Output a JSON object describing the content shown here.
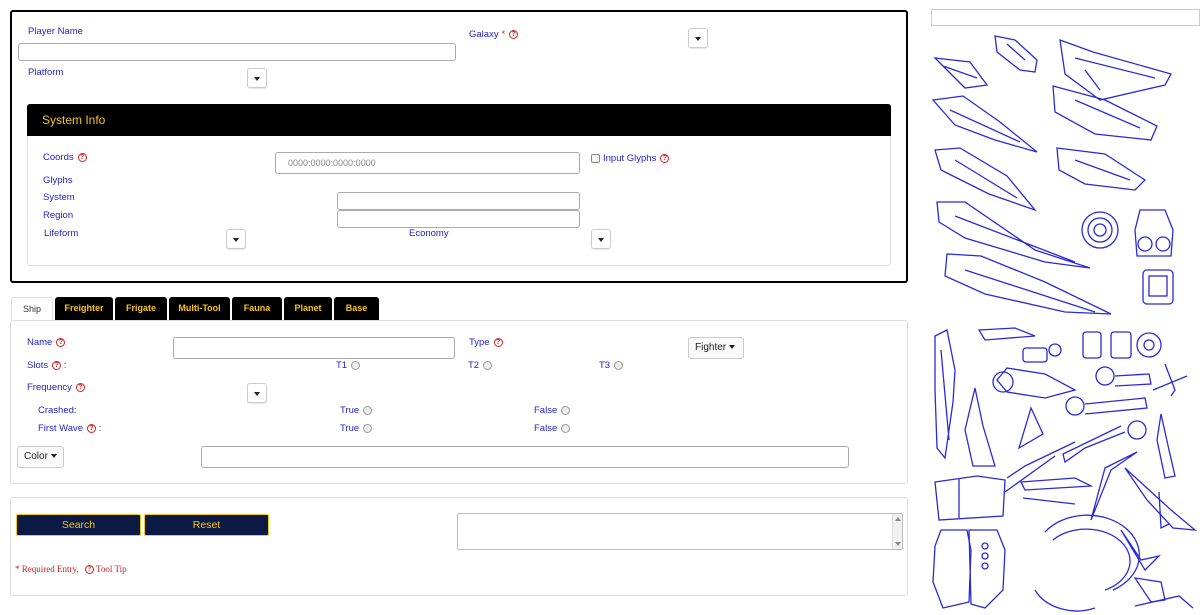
{
  "player": {
    "player_name_label": "Player Name",
    "galaxy_label": "Galaxy",
    "required_mark": "*",
    "platform_label": "Platform"
  },
  "system_info": {
    "header": "System Info",
    "coords_label": "Coords",
    "coords_placeholder": "0000:0000:0000:0000",
    "input_glyphs_label": "Input Glyphs",
    "glyphs_label": "Glyphs",
    "system_label": "System",
    "region_label": "Region",
    "lifeform_label": "Lifeform",
    "economy_label": "Economy"
  },
  "tabs": [
    "Ship",
    "Freighter",
    "Frigate",
    "Multi-Tool",
    "Fauna",
    "Planet",
    "Base"
  ],
  "ship": {
    "name_label": "Name",
    "type_label": "Type",
    "type_value": "Fighter",
    "slots_label": "Slots",
    "slots_colon": ":",
    "t1": "T1",
    "t2": "T2",
    "t3": "T3",
    "frequency_label": "Frequency",
    "crashed_label": "Crashed:",
    "first_wave_label": "First Wave",
    "first_wave_colon": ":",
    "true_label": "True",
    "false_label": "False",
    "color_label": "Color"
  },
  "actions": {
    "search_label": "Search",
    "reset_label": "Reset",
    "required_entry_text": "* Required Entry,",
    "tooltip_text": "Tool Tip"
  },
  "colors": {
    "label_blue": "#2323c9",
    "header_black": "#000000",
    "accent_yellow": "#f5c518",
    "button_navy": "#0b1a44",
    "help_red": "#d42020",
    "sketch_blue": "#2a2ad6"
  },
  "icons": [
    "help-icon",
    "caret-down-icon",
    "ship-sketch-image"
  ]
}
